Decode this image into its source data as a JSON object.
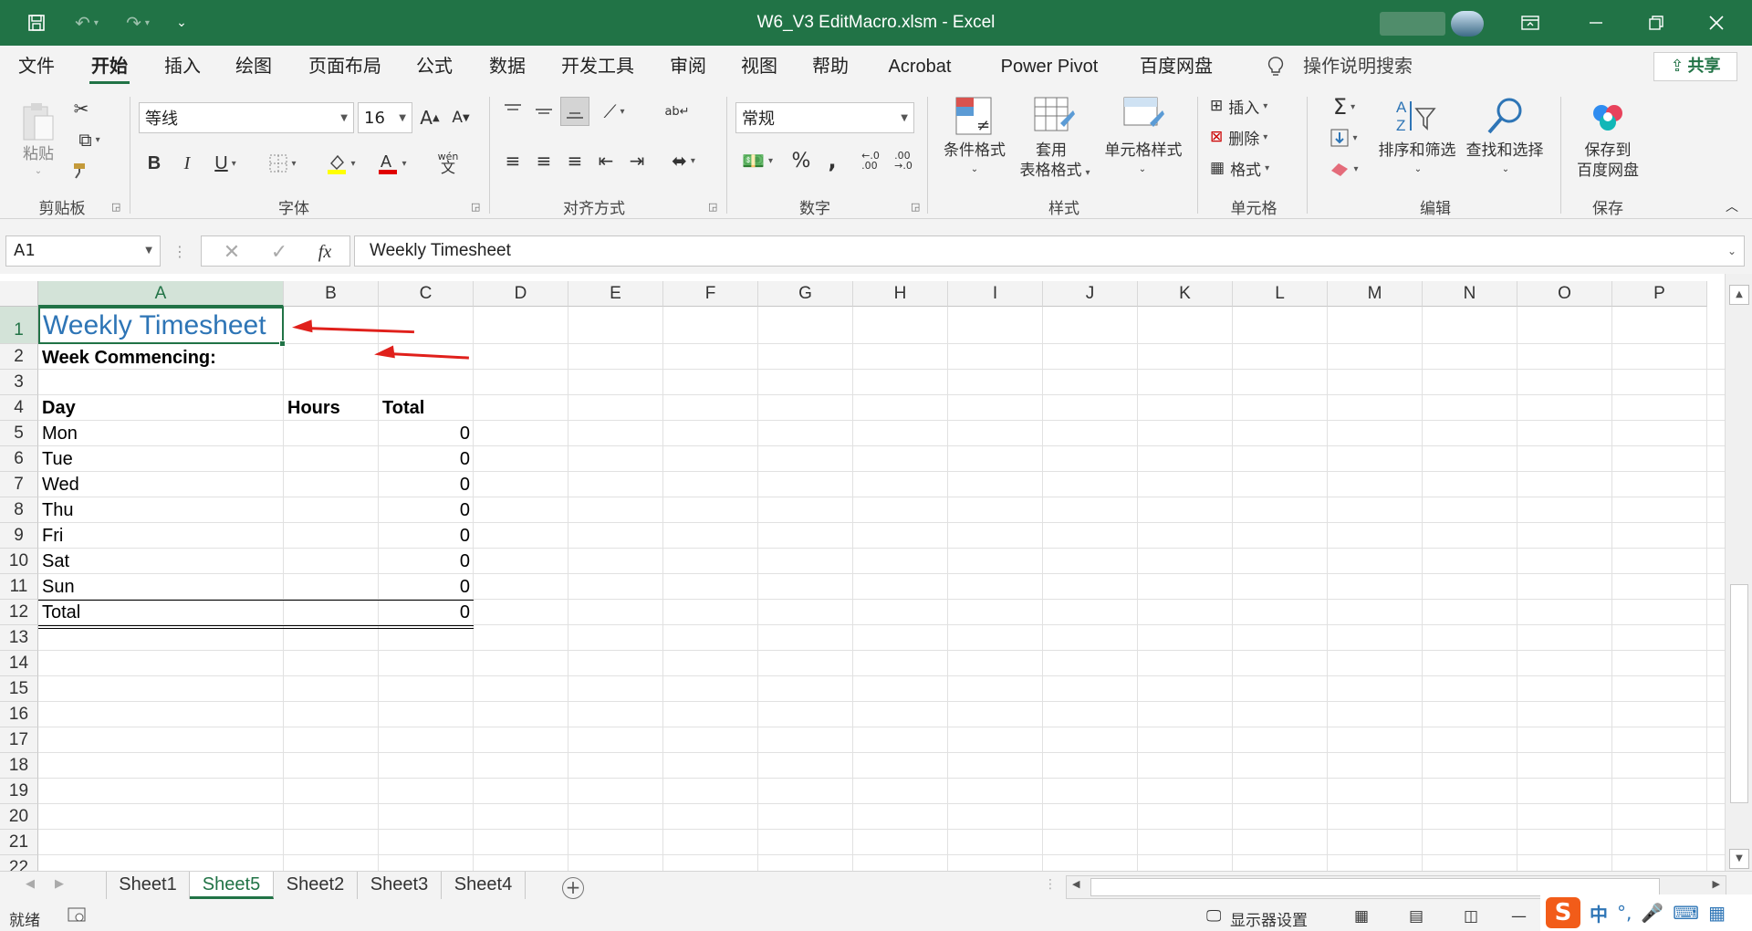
{
  "window": {
    "title": "W6_V3 EditMacro.xlsm  -  Excel",
    "colors": {
      "brand": "#217346",
      "accent_text": "#2e75b6",
      "annotation": "#e0201b"
    }
  },
  "menu": {
    "tabs": [
      "文件",
      "开始",
      "插入",
      "绘图",
      "页面布局",
      "公式",
      "数据",
      "开发工具",
      "审阅",
      "视图",
      "帮助",
      "Acrobat",
      "Power Pivot",
      "百度网盘"
    ],
    "active_tab": "开始",
    "search_label": "操作说明搜索",
    "share_label": "共享"
  },
  "ribbon": {
    "clipboard": {
      "paste_label": "粘贴",
      "group_label": "剪贴板"
    },
    "font": {
      "font_name": "等线",
      "font_size": "16",
      "group_label": "字体",
      "bold": "B",
      "italic": "I",
      "underline": "U",
      "phonetic_top": "wén",
      "phonetic_bottom": "文"
    },
    "alignment": {
      "group_label": "对齐方式"
    },
    "number": {
      "format": "常规",
      "group_label": "数字",
      "percent": "%",
      "comma": ","
    },
    "styles": {
      "conditional": "条件格式",
      "table_format_1": "套用",
      "table_format_2": "表格格式",
      "cell_styles": "单元格样式",
      "group_label": "样式"
    },
    "cells": {
      "insert": "插入",
      "delete": "删除",
      "format": "格式",
      "group_label": "单元格"
    },
    "editing": {
      "sort_filter": "排序和筛选",
      "find_select": "查找和选择",
      "group_label": "编辑",
      "sum_symbol": "Σ"
    },
    "save": {
      "save_to_1": "保存到",
      "save_to_2": "百度网盘",
      "group_label": "保存"
    }
  },
  "formula_bar": {
    "name_box": "A1",
    "fx": "fx",
    "content": "Weekly Timesheet"
  },
  "grid": {
    "columns": [
      "A",
      "B",
      "C",
      "D",
      "E",
      "F",
      "G",
      "H",
      "I",
      "J",
      "K",
      "L",
      "M",
      "N",
      "O",
      "P"
    ],
    "rows": [
      "1",
      "2",
      "3",
      "4",
      "5",
      "6",
      "7",
      "8",
      "9",
      "10",
      "11",
      "12",
      "13",
      "14",
      "15",
      "16",
      "17",
      "18",
      "19",
      "20",
      "21",
      "22"
    ],
    "selected_cell": "A1",
    "cells": {
      "A1": "Weekly Timesheet",
      "A2": "Week Commencing:",
      "A4": "Day",
      "B4": "Hours",
      "C4": "Total",
      "A5": "Mon",
      "C5": "0",
      "A6": "Tue",
      "C6": "0",
      "A7": "Wed",
      "C7": "0",
      "A8": "Thu",
      "C8": "0",
      "A9": "Fri",
      "C9": "0",
      "A10": "Sat",
      "C10": "0",
      "A11": "Sun",
      "C11": "0",
      "A12": "Total",
      "C12": "0"
    }
  },
  "sheets": {
    "tabs": [
      "Sheet1",
      "Sheet5",
      "Sheet2",
      "Sheet3",
      "Sheet4"
    ],
    "active": "Sheet5"
  },
  "status_bar": {
    "ready": "就绪",
    "display_settings": "显示器设置",
    "ime_chinese": "中"
  }
}
